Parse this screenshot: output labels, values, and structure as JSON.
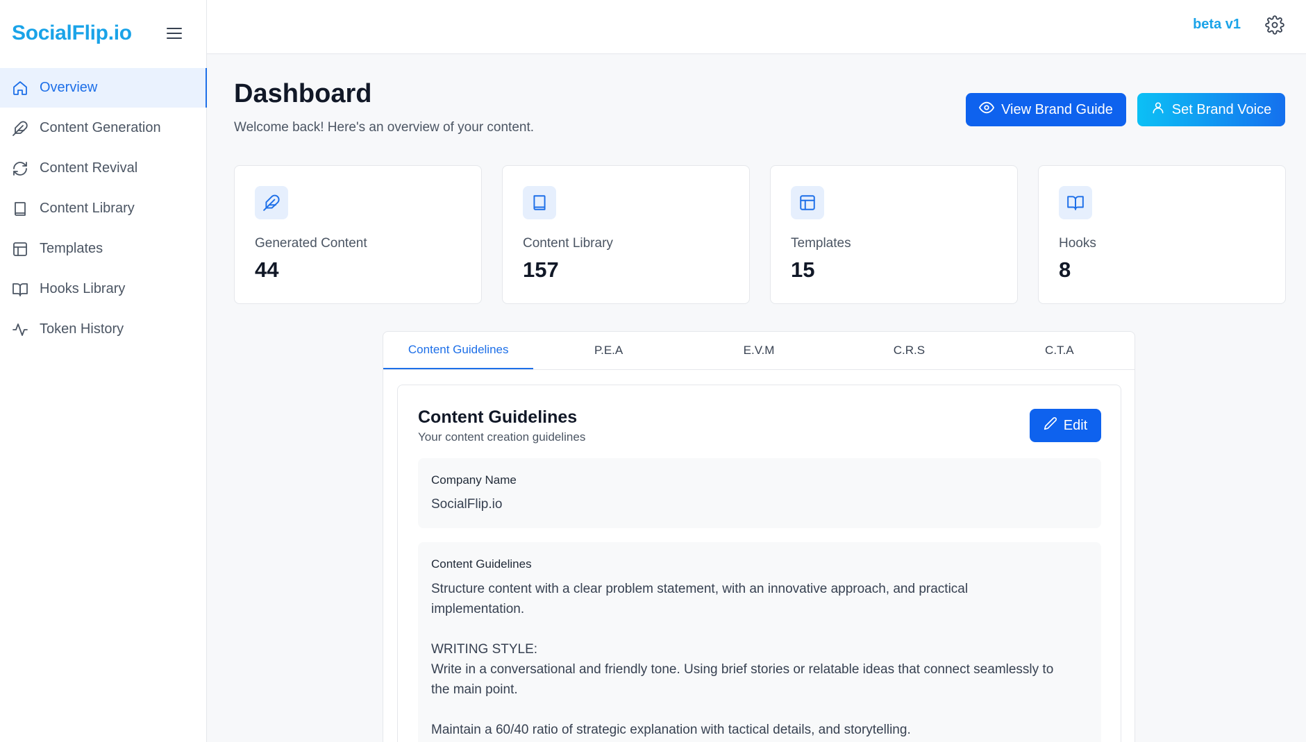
{
  "brand": {
    "name": "SocialFlip.io",
    "color": "#1aa3e8"
  },
  "sidebar": {
    "items": [
      {
        "label": "Overview",
        "icon": "home-icon",
        "active": true
      },
      {
        "label": "Content Generation",
        "icon": "feather-icon"
      },
      {
        "label": "Content Revival",
        "icon": "refresh-icon"
      },
      {
        "label": "Content Library",
        "icon": "book-icon"
      },
      {
        "label": "Templates",
        "icon": "layout-icon"
      },
      {
        "label": "Hooks Library",
        "icon": "book-open-icon"
      },
      {
        "label": "Token History",
        "icon": "activity-icon"
      }
    ]
  },
  "topbar": {
    "version": "beta v1"
  },
  "header": {
    "title": "Dashboard",
    "subtitle": "Welcome back! Here's an overview of your content.",
    "view_guide_label": "View Brand Guide",
    "set_voice_label": "Set Brand Voice"
  },
  "stats": [
    {
      "label": "Generated Content",
      "value": "44",
      "icon": "feather-icon"
    },
    {
      "label": "Content Library",
      "value": "157",
      "icon": "book-icon"
    },
    {
      "label": "Templates",
      "value": "15",
      "icon": "layout-icon"
    },
    {
      "label": "Hooks",
      "value": "8",
      "icon": "book-open-icon"
    }
  ],
  "tabs": [
    {
      "label": "Content Guidelines",
      "active": true
    },
    {
      "label": "P.E.A"
    },
    {
      "label": "E.V.M"
    },
    {
      "label": "C.R.S"
    },
    {
      "label": "C.T.A"
    }
  ],
  "guidelines": {
    "title": "Content Guidelines",
    "subtitle": "Your content creation guidelines",
    "edit_label": "Edit",
    "company_label": "Company Name",
    "company_value": "SocialFlip.io",
    "guidelines_label": "Content Guidelines",
    "guidelines_value": "Structure content with a clear problem statement, with an innovative approach, and practical implementation.\n\nWRITING STYLE:\nWrite in a conversational and friendly tone. Using brief stories or relatable ideas that connect seamlessly to the main point.\n\nMaintain a 60/40 ratio of strategic explanation with tactical details, and storytelling."
  },
  "colors": {
    "primary": "#0e62ee",
    "accent": "#1aa3e8",
    "active_nav_bg": "#eaf2fe"
  }
}
